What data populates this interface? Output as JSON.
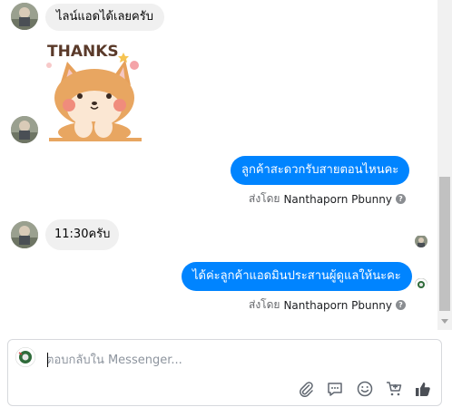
{
  "messages": {
    "m1": {
      "text": "ไลน์แอดได้เลยครับ"
    },
    "m2": {
      "sticker": "thanks-shiba-sticker",
      "sticker_text": "THANKS"
    },
    "m3": {
      "text": "ลูกค้าสะดวกรับสายตอนไหนคะ"
    },
    "m4": {
      "text": "11:30ครับ"
    },
    "m5": {
      "text": "ได้ค่ะลูกค้าแอดมินประสานผู้ดูแลให้นะคะ"
    }
  },
  "sent_by": {
    "prefix": "ส่งโดย",
    "name": "Nanthaporn Pbunny",
    "info": "?"
  },
  "composer": {
    "placeholder": "ตอบกลับใน Messenger...",
    "value": "",
    "tools": [
      "attach-icon",
      "saved-reply-icon",
      "emoji-icon",
      "cart-icon",
      "like-icon"
    ]
  },
  "colors": {
    "outgoing_bubble": "#0084ff",
    "incoming_bubble": "#f0f0f0",
    "meta_text": "#65676b",
    "like_icon": "#4b4f56"
  }
}
